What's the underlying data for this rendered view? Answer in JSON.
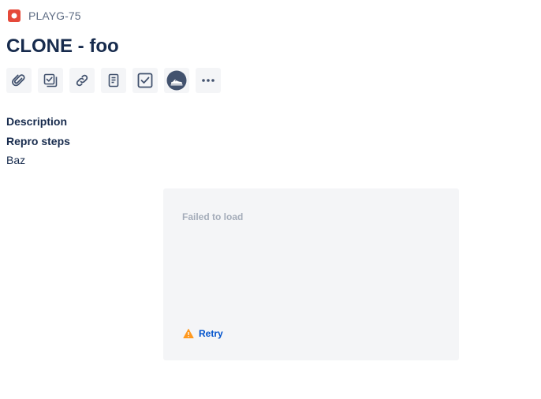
{
  "breadcrumb": {
    "issue_key": "PLAYG-75",
    "issue_type_icon": "bug-icon"
  },
  "title": "CLONE - foo",
  "toolbar": {
    "buttons": [
      {
        "icon": "attachment-icon"
      },
      {
        "icon": "subtask-icon"
      },
      {
        "icon": "link-icon"
      },
      {
        "icon": "page-icon"
      },
      {
        "icon": "checklist-icon"
      },
      {
        "icon": "app-avatar-icon"
      },
      {
        "icon": "more-icon"
      }
    ]
  },
  "description": {
    "label": "Description"
  },
  "repro": {
    "label": "Repro steps",
    "text": "Baz"
  },
  "error_panel": {
    "message": "Failed to load",
    "retry_label": "Retry",
    "icon": "warning-icon"
  },
  "colors": {
    "bug": "#e5493a",
    "accent": "#0052cc",
    "warning": "#ff991f",
    "panel": "#f4f5f7",
    "text": "#172b4d"
  }
}
